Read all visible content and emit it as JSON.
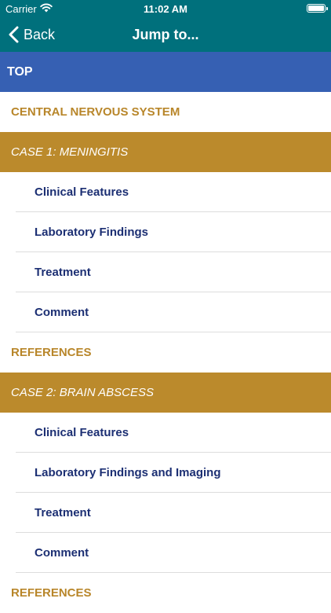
{
  "status_bar": {
    "carrier": "Carrier",
    "time": "11:02 AM",
    "wifi_icon": "wifi-icon",
    "battery_icon": "battery-icon"
  },
  "nav": {
    "back_label": "Back",
    "back_icon": "chevron-left-icon",
    "title": "Jump to..."
  },
  "list": {
    "top": "TOP",
    "section_1": "CENTRAL NERVOUS SYSTEM",
    "case_1": {
      "title": "CASE 1: MENINGITIS",
      "items": [
        "Clinical Features",
        "Laboratory Findings",
        "Treatment",
        "Comment"
      ]
    },
    "references_1": "REFERENCES",
    "case_2": {
      "title": "CASE 2: BRAIN ABSCESS",
      "items": [
        "Clinical Features",
        "Laboratory Findings and Imaging",
        "Treatment",
        "Comment"
      ]
    },
    "references_2": "REFERENCES"
  },
  "colors": {
    "nav_background": "#00707c",
    "top_row": "#3660b3",
    "case_row": "#bb8a2c",
    "section_text": "#b8862a",
    "item_text": "#1c2f73"
  }
}
